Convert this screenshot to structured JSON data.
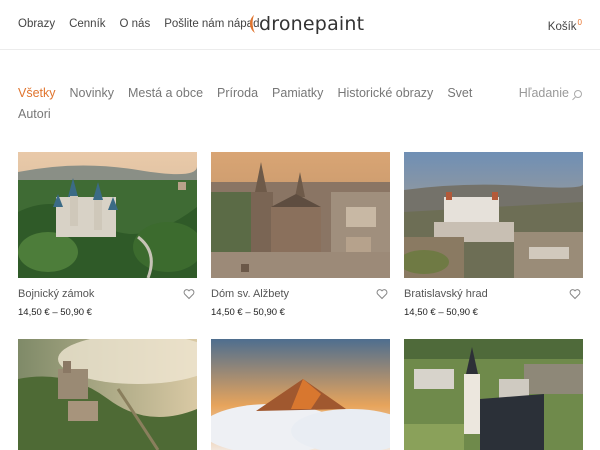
{
  "header": {
    "nav": [
      "Obrazy",
      "Cenník",
      "O nás",
      "Pošlite nám nápad"
    ],
    "logo_text": "dronepaint",
    "cart_label": "Košík",
    "cart_count": "0"
  },
  "filters": {
    "categories": [
      "Všetky",
      "Novinky",
      "Mestá a obce",
      "Príroda",
      "Pamiatky",
      "Historické obrazy",
      "Svet",
      "Autori"
    ],
    "active": "Všetky",
    "search_label": "Hľadanie"
  },
  "products": [
    {
      "name": "Bojnický zámok",
      "price": "14,50 € – 50,90 €",
      "icon": "heart-icon"
    },
    {
      "name": "Dóm sv. Alžbety",
      "price": "14,50 € – 50,90 €",
      "icon": "heart-icon"
    },
    {
      "name": "Bratislavský hrad",
      "price": "14,50 € – 50,90 €",
      "icon": "heart-icon"
    },
    {
      "name": "",
      "price": ""
    },
    {
      "name": "",
      "price": ""
    },
    {
      "name": "",
      "price": ""
    }
  ],
  "colors": {
    "accent": "#e0752f",
    "text": "#444444",
    "muted": "#777777"
  }
}
